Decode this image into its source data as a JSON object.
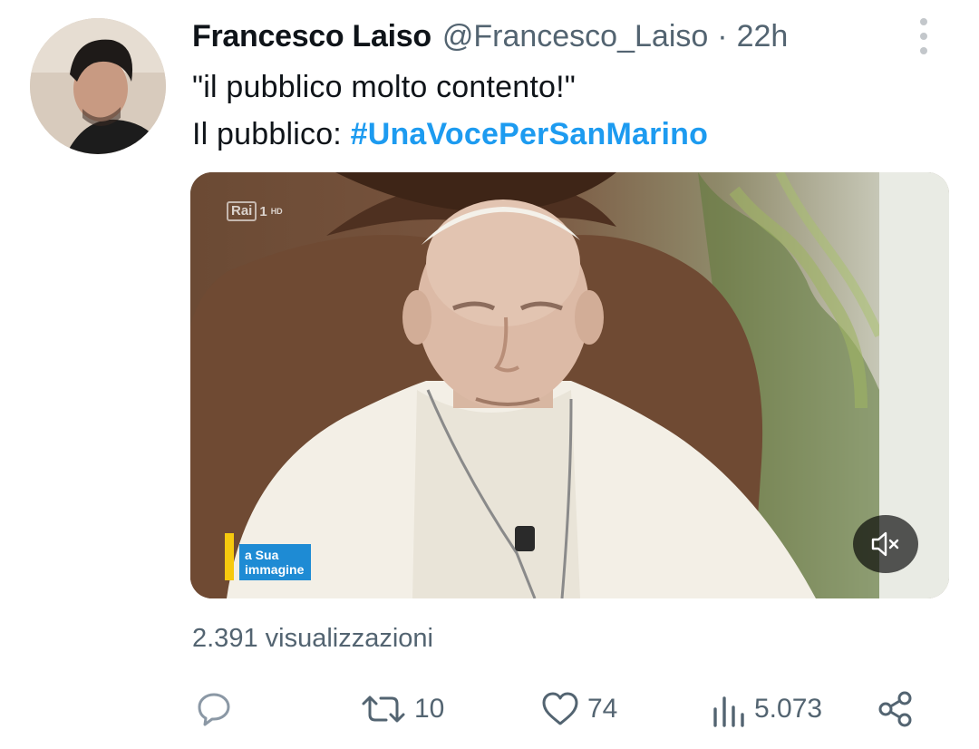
{
  "tweet": {
    "author": {
      "display_name": "Francesco Laiso",
      "handle": "@Francesco_Laiso",
      "separator": "·",
      "time": "22h"
    },
    "text_line1": "\"il pubblico molto contento!\"",
    "text_line2_prefix": "Il pubblico: ",
    "hashtag": "#UnaVocePerSanMarino",
    "media": {
      "channel_logo": "Rai",
      "channel_number": "1",
      "channel_hd": "HD",
      "program_logo_line1": "a Sua",
      "program_logo_line2": "immagine",
      "mute_icon": "volume-muted-icon"
    },
    "views_text": "2.391 visualizzazioni",
    "actions": {
      "reply_icon": "reply-icon",
      "retweet_icon": "retweet-icon",
      "retweet_count": "10",
      "like_icon": "heart-icon",
      "like_count": "74",
      "views_icon": "bar-chart-icon",
      "views_count": "5.073",
      "share_icon": "share-icon"
    },
    "colors": {
      "accent": "#1d9bf0",
      "secondary_text": "#536471",
      "primary_text": "#0f1419"
    }
  }
}
